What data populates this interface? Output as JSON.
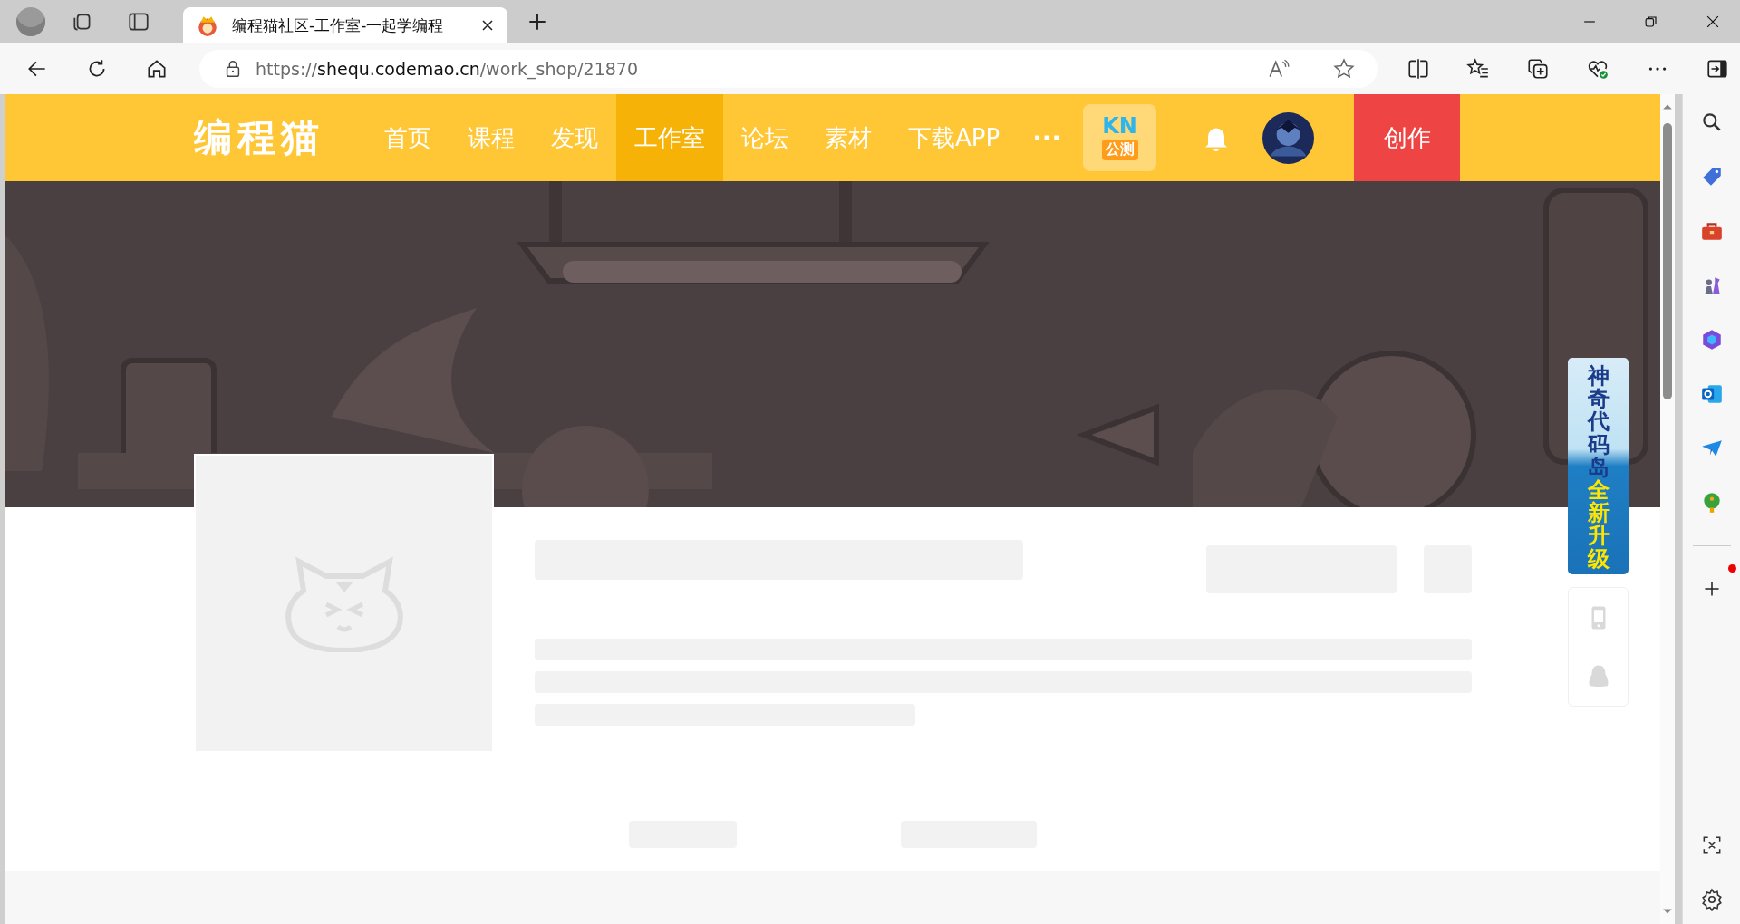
{
  "browser": {
    "tab": {
      "title": "编程猫社区-工作室-一起学编程",
      "selected": true
    },
    "address": {
      "scheme": "https://",
      "host": "shequ.codemao.cn",
      "path": "/work_shop/21870"
    }
  },
  "site_nav": {
    "logo": "编程猫",
    "items": [
      {
        "label": "首页",
        "selected": false
      },
      {
        "label": "课程",
        "selected": false
      },
      {
        "label": "发现",
        "selected": false
      },
      {
        "label": "工作室",
        "selected": true
      },
      {
        "label": "论坛",
        "selected": false
      },
      {
        "label": "素材",
        "selected": false
      },
      {
        "label": "下载APP",
        "selected": false
      }
    ],
    "more": "···",
    "badge": {
      "top": "KN",
      "bottom": "公测"
    },
    "create_button": "创作"
  },
  "side_banner": {
    "title": "神奇代码岛",
    "subtitle": "全新升级"
  }
}
